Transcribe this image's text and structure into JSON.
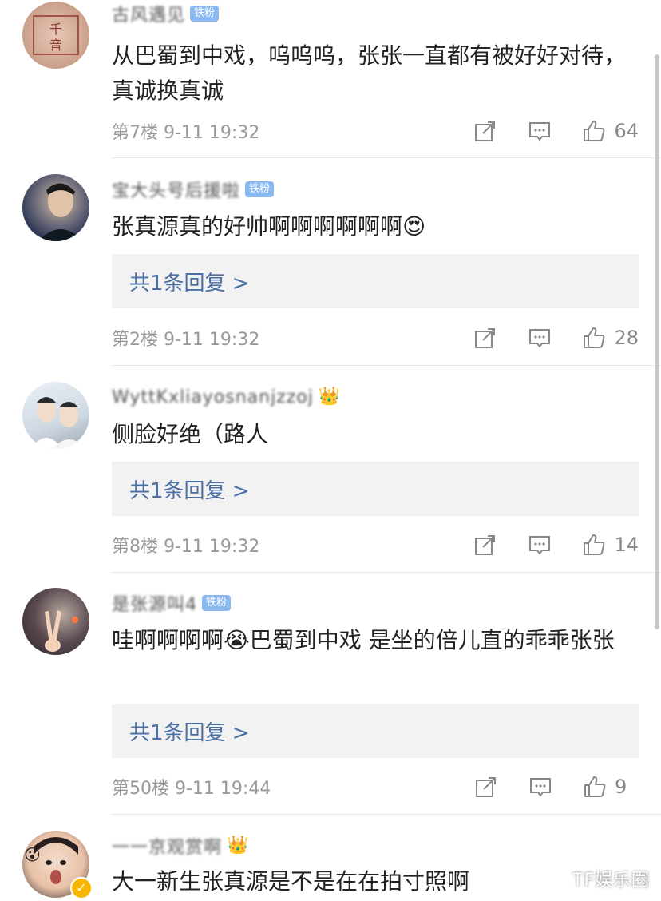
{
  "comments": [
    {
      "username": "古风遇见",
      "badge": "铁粉",
      "text": "从巴蜀到中戏，呜呜呜，张张一直都有被好好对待，真诚换真诚",
      "meta": "第7楼 9-11 19:32",
      "likes": "64",
      "reply": ""
    },
    {
      "username": "宝大头号后援啦",
      "badge": "铁粉",
      "text": "张真源真的好帅啊啊啊啊啊啊",
      "emoji": "😍",
      "meta": "第2楼 9-11 19:32",
      "likes": "28",
      "reply": "共1条回复 >"
    },
    {
      "username": "WyttKxliayosnanjzzoj",
      "badge": "",
      "text": "侧脸好绝（路人",
      "meta": "第8楼 9-11 19:32",
      "likes": "14",
      "reply": "共1条回复 >"
    },
    {
      "username": "是张源叫4",
      "badge": "铁粉",
      "text_a": "哇啊啊啊啊",
      "emoji": "😭",
      "text_b": "巴蜀到中戏   是坐的倍儿直的乖乖张张",
      "meta": "第50楼 9-11 19:44",
      "likes": "9",
      "reply": "共1条回复 >"
    },
    {
      "username": "一一京观赏啊",
      "badge": "",
      "text": "大一新生张真源是不是在在拍寸照啊",
      "meta": "",
      "likes": "",
      "reply": ""
    }
  ],
  "watermark": "TF娱乐圈",
  "icons": {
    "share": "share-icon",
    "comment": "comment-icon",
    "like": "thumbs-up-icon",
    "crown": "crown-icon",
    "verified": "verified-icon"
  },
  "colors": {
    "badge": "#8ab8f0",
    "reply_text": "#4a6fa5",
    "meta": "#999999"
  }
}
